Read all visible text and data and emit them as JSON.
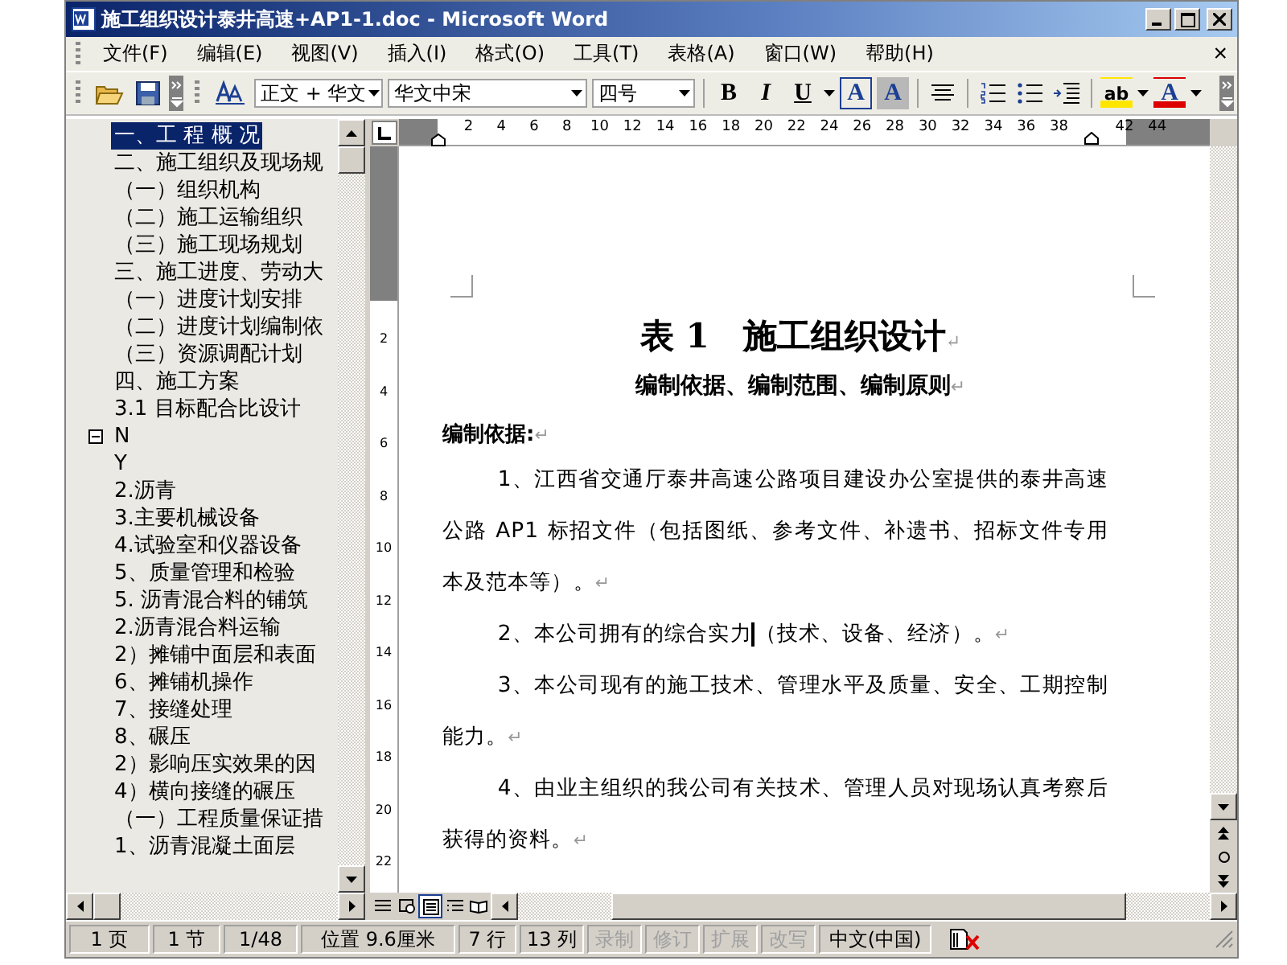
{
  "window": {
    "title": "施工组织设计泰井高速+AP1-1.doc - Microsoft Word"
  },
  "menu": [
    "文件(F)",
    "编辑(E)",
    "视图(V)",
    "插入(I)",
    "格式(O)",
    "工具(T)",
    "表格(A)",
    "窗口(W)",
    "帮助(H)"
  ],
  "menu_close": "×",
  "toolbar": {
    "style": "正文 + 华文",
    "font": "华文中宋",
    "size": "四号",
    "buttons": [
      {
        "kind": "bold",
        "label": "B"
      },
      {
        "kind": "italic",
        "label": "I"
      },
      {
        "kind": "underline",
        "label": "U"
      },
      {
        "kind": "border",
        "label": "A"
      },
      {
        "kind": "shade",
        "label": "A"
      },
      {
        "kind": "highlight",
        "label": "ab"
      },
      {
        "kind": "fontcolor",
        "label": "A"
      }
    ]
  },
  "document_map": [
    {
      "label": "一、工 程 概 况",
      "selected": true
    },
    {
      "label": "二、施工组织及现场规",
      "selected": false
    },
    {
      "label": "（一）组织机构",
      "selected": false
    },
    {
      "label": "（二）施工运输组织",
      "selected": false
    },
    {
      "label": "（三）施工现场规划",
      "selected": false
    },
    {
      "label": "三、施工进度、劳动大",
      "selected": false
    },
    {
      "label": "（一）进度计划安排",
      "selected": false
    },
    {
      "label": "（二）进度计划编制依",
      "selected": false
    },
    {
      "label": "（三）资源调配计划",
      "selected": false
    },
    {
      "label": "四、施工方案",
      "selected": false
    },
    {
      "label": "3.1 目标配合比设计",
      "selected": false
    },
    {
      "label": "N",
      "selected": false,
      "expanded": true,
      "children": [
        {
          "label": "Y",
          "selected": false
        }
      ]
    },
    {
      "label": "2.沥青",
      "selected": false
    },
    {
      "label": "3.主要机械设备",
      "selected": false
    },
    {
      "label": "4.试验室和仪器设备",
      "selected": false
    },
    {
      "label": "5、质量管理和检验",
      "selected": false
    },
    {
      "label": "5. 沥青混合料的铺筑",
      "selected": false
    },
    {
      "label": "2.沥青混合料运输",
      "selected": false
    },
    {
      "label": "2）摊铺中面层和表面",
      "selected": false
    },
    {
      "label": "6、摊铺机操作",
      "selected": false
    },
    {
      "label": "7、接缝处理",
      "selected": false
    },
    {
      "label": "8、碾压",
      "selected": false
    },
    {
      "label": "2）影响压实效果的因",
      "selected": false
    },
    {
      "label": "4）横向接缝的碾压",
      "selected": false
    },
    {
      "label": "（一）工程质量保证措",
      "selected": false
    },
    {
      "label": "1、沥青混凝土面层",
      "selected": false
    }
  ],
  "ruler": {
    "horizontal": [
      "2",
      "4",
      "6",
      "8",
      "10",
      "12",
      "14",
      "16",
      "18",
      "20",
      "22",
      "24",
      "26",
      "28",
      "30",
      "32",
      "34",
      "36",
      "38",
      "42",
      "44"
    ],
    "vertical": [
      "2",
      "4",
      "6",
      "8",
      "10",
      "12",
      "14",
      "16",
      "18",
      "20",
      "22"
    ]
  },
  "document": {
    "title": "表 1　施工组织设计",
    "subtitle": "编制依据、编制范围、编制原则",
    "heading": "编制依据:",
    "mark": "↵",
    "paragraphs": [
      {
        "text": "1、江西省交通厅泰井高速公路项目建设办公室提供的泰井高速公路 AP1 标招文件（包括图纸、参考文件、补遗书、招标文件专用本及范本等）。"
      },
      {
        "text": "2、本公司拥有的综合实力",
        "text_after_cursor": "（技术、设备、经济）。"
      },
      {
        "text": "3、本公司现有的施工技术、管理水平及质量、安全、工期控制能力。"
      },
      {
        "text": "4、由业主组织的我公司有关技术、管理人员对现场认真考察后获得的资料。"
      }
    ]
  },
  "status_bar": {
    "fields": [
      {
        "text": "1 页",
        "disabled": false
      },
      {
        "text": "1 节",
        "disabled": false
      },
      {
        "text": "1/48",
        "disabled": false
      },
      {
        "text": "位置 9.6厘米",
        "disabled": false
      },
      {
        "text": "7 行",
        "disabled": false
      },
      {
        "text": "13 列",
        "disabled": false
      },
      {
        "text": "录制",
        "disabled": true
      },
      {
        "text": "修订",
        "disabled": true
      },
      {
        "text": "扩展",
        "disabled": true
      },
      {
        "text": "改写",
        "disabled": true
      },
      {
        "text": "中文(中国)",
        "disabled": false
      }
    ]
  }
}
